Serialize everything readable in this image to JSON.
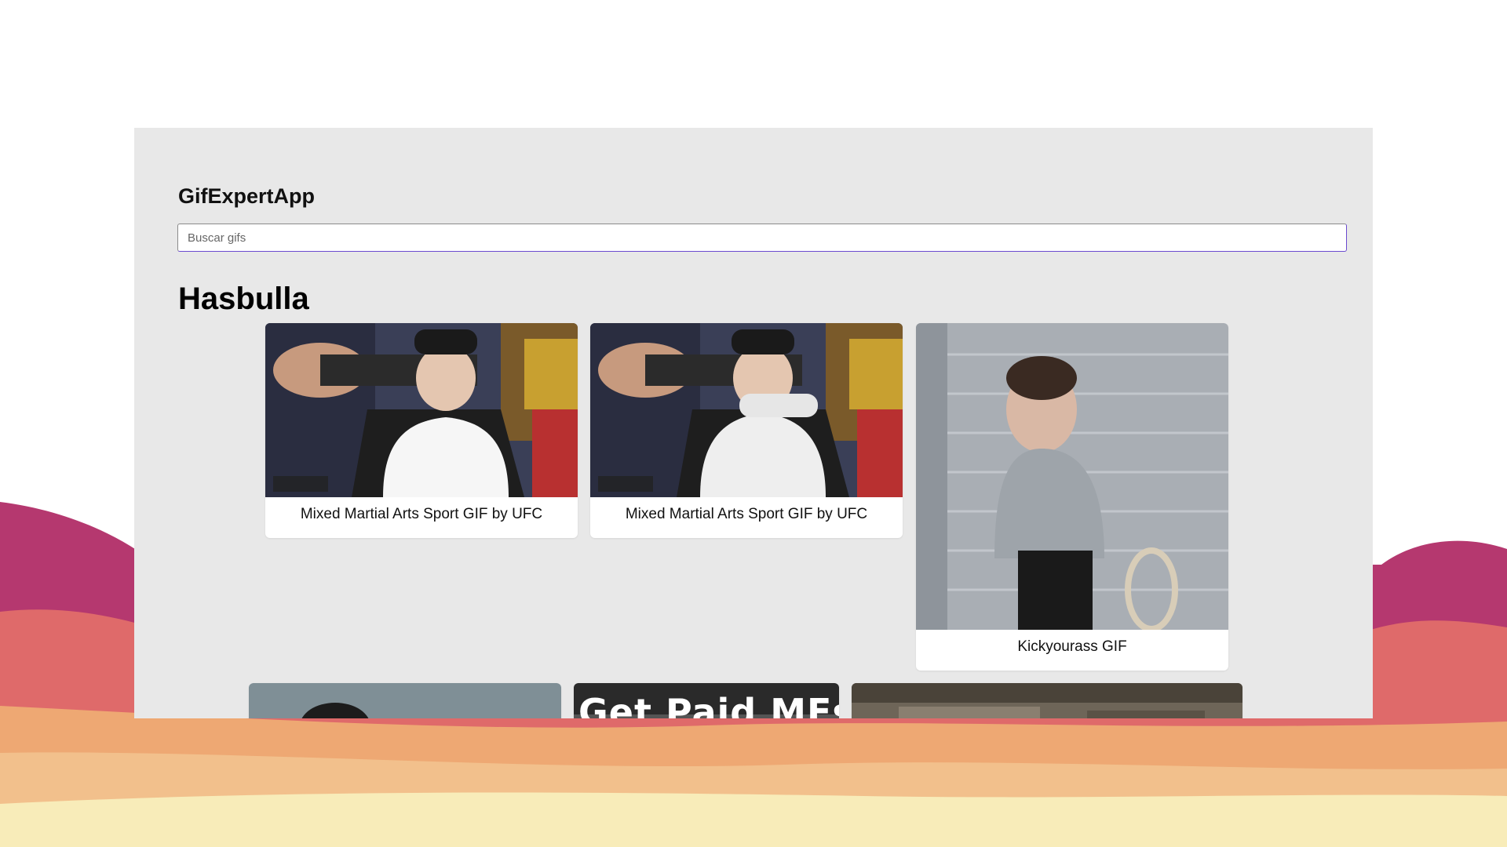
{
  "app": {
    "title": "GifExpertApp"
  },
  "search": {
    "placeholder": "Buscar gifs",
    "value": ""
  },
  "category": {
    "title": "Hasbulla"
  },
  "gifs": [
    {
      "title": "Mixed Martial Arts Sport GIF by UFC"
    },
    {
      "title": "Mixed Martial Arts Sport GIF by UFC"
    },
    {
      "title": "Kickyourass GIF"
    },
    {
      "title": ""
    },
    {
      "title": "",
      "overlay_text": "Get Paid MFs"
    },
    {
      "title": ""
    }
  ],
  "colors": {
    "app_background": "#e8e8e8",
    "card_background": "#ffffff",
    "wave_magenta": "#b5386f",
    "wave_coral": "#df6a6a",
    "wave_orange": "#eea873",
    "wave_cream": "#f8ecb9",
    "input_focus_border": "#6a4ad0"
  }
}
